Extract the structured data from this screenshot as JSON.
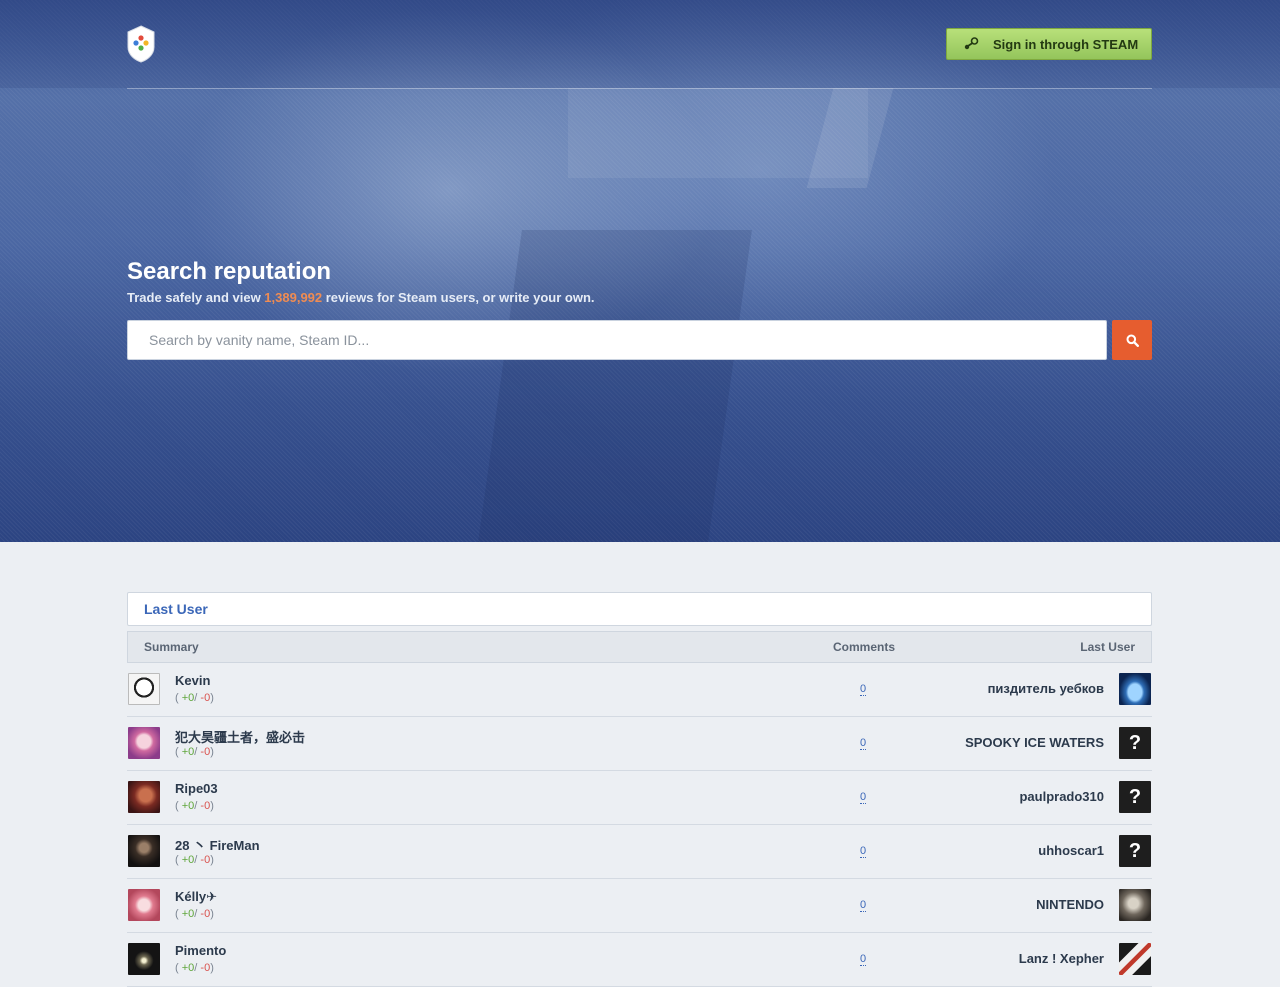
{
  "header": {
    "logo_icon": "shield-logo-icon",
    "signin_label": "Sign in through STEAM",
    "signin_icon": "steam-icon"
  },
  "search": {
    "title": "Search reputation",
    "sub_prefix": "Trade safely and view ",
    "review_count": "1,389,992",
    "sub_suffix": " reviews for Steam users, or write your own.",
    "placeholder": "Search by vanity name, Steam ID...",
    "button_icon": "search-icon",
    "button_color": "#e65d2f"
  },
  "panel": {
    "title": "Last User",
    "columns": {
      "summary": "Summary",
      "comments": "Comments",
      "last_user": "Last User"
    }
  },
  "rows": [
    {
      "name": "Kevin",
      "rep_open": "( ",
      "pos": "+0",
      "sep": "/ ",
      "neg": "-0",
      "rep_close": ")",
      "comments": "0",
      "last_user": "пиздитель уебков",
      "avatar": "anime-sketch-avatar",
      "last_avatar": "earth-avatar"
    },
    {
      "name": "犯大昊疆土者，盛必击",
      "rep_open": "( ",
      "pos": "+0",
      "sep": "/ ",
      "neg": "-0",
      "rep_close": ")",
      "comments": "0",
      "last_user": "SPOOKY ICE WATERS",
      "avatar": "pink-anime-avatar",
      "last_avatar": "question-mark-avatar"
    },
    {
      "name": "Ripe03",
      "rep_open": "( ",
      "pos": "+0",
      "sep": "/ ",
      "neg": "-0",
      "rep_close": ")",
      "comments": "0",
      "last_user": "paulprado310",
      "avatar": "red-portrait-avatar",
      "last_avatar": "question-mark-avatar"
    },
    {
      "name": "28 丶 FireMan",
      "rep_open": "( ",
      "pos": "+0",
      "sep": "/ ",
      "neg": "-0",
      "rep_close": ")",
      "comments": "0",
      "last_user": "uhhoscar1",
      "avatar": "dark-figure-avatar",
      "last_avatar": "question-mark-avatar"
    },
    {
      "name": "Kélly✈",
      "rep_open": "( ",
      "pos": "+0",
      "sep": "/ ",
      "neg": "-0",
      "rep_close": ")",
      "comments": "0",
      "last_user": "NINTENDO",
      "avatar": "anime-girl-avatar",
      "last_avatar": "grey-portrait-avatar"
    },
    {
      "name": "Pimento",
      "rep_open": "( ",
      "pos": "+0",
      "sep": "/ ",
      "neg": "-0",
      "rep_close": ")",
      "comments": "0",
      "last_user": "Lanz ! Xepher",
      "avatar": "black-orb-avatar",
      "last_avatar": "cards-avatar"
    }
  ]
}
